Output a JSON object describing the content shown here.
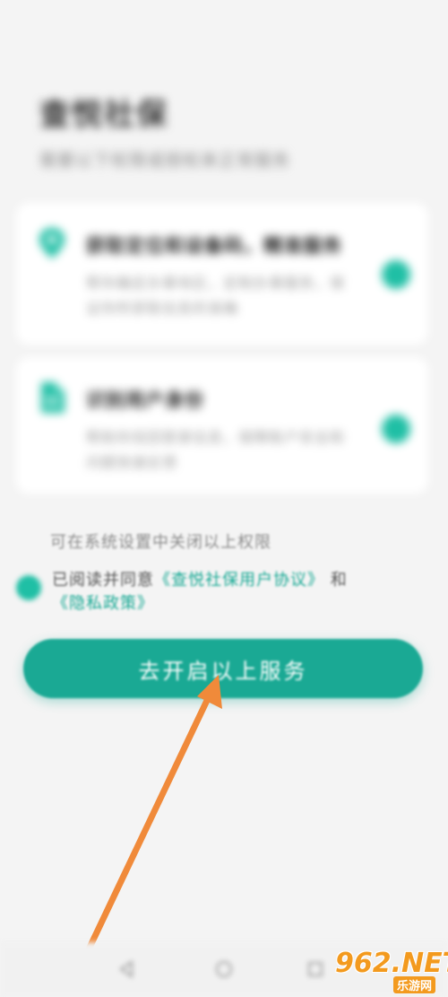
{
  "page": {
    "title": "查悦社保",
    "subtitle": "需要以下权限或授权来正常服务"
  },
  "cards": [
    {
      "icon": "location-pin-icon",
      "title": "获取定位和设备码，精准服务",
      "desc": "帮你确定办事地区，定制办事服务，保证你所获取信息的准确"
    },
    {
      "icon": "document-icon",
      "title": "识别用户身份",
      "desc": "帮助你找回登录信息，保障账户安全和问题快速反馈"
    }
  ],
  "permission_note": "可在系统设置中关闭以上权限",
  "agreement": {
    "prefix": "已阅读并同意",
    "user_agreement": "《查悦社保用户协议》",
    "conjunction": "和",
    "privacy_policy": "《隐私政策》"
  },
  "primary_button": {
    "label": "去开启以上服务"
  },
  "watermark": {
    "text": "962.NET",
    "sub": "乐游网"
  },
  "colors": {
    "accent": "#1aa994",
    "toggle": "#1fbfa5",
    "link": "#16a893",
    "arrow": "#f08a3a",
    "watermark": "#f39a1e"
  }
}
